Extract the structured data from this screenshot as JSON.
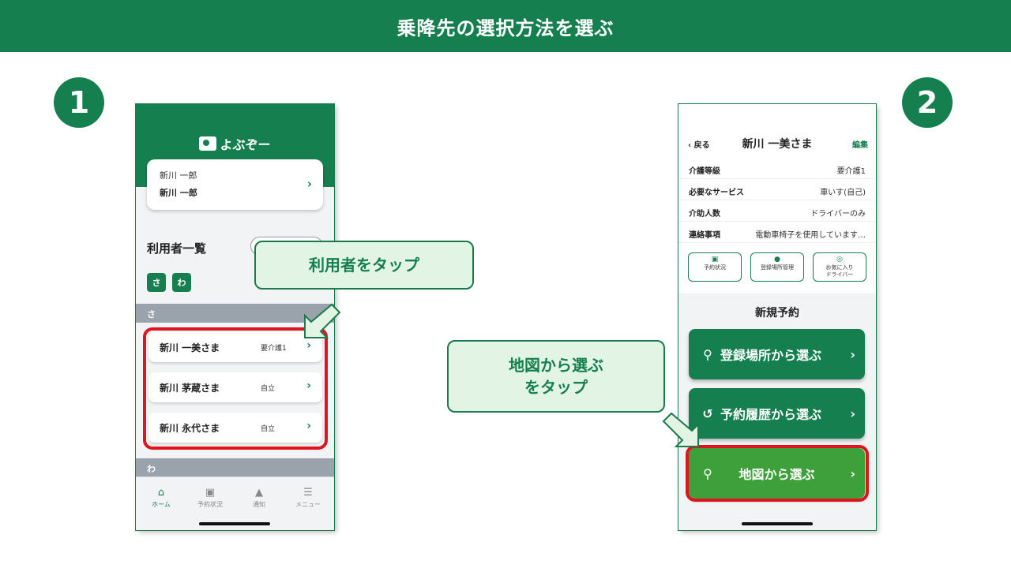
{
  "header": {
    "title": "乗降先の選択方法を選ぶ"
  },
  "steps": {
    "one": "❶",
    "two": "❷"
  },
  "phone1": {
    "app_name": "よぶぞー",
    "account": {
      "line1": "新川 一郎",
      "line2": "新川 一郎"
    },
    "list_title": "利用者一覧",
    "kana_buttons": [
      "さ",
      "わ"
    ],
    "sections": [
      "さ",
      "わ"
    ],
    "users": [
      {
        "name": "新川 一美さま",
        "badge": "要介護1"
      },
      {
        "name": "新川 茅蔵さま",
        "badge": "自立"
      },
      {
        "name": "新川 永代さま",
        "badge": "自立"
      }
    ],
    "tabs": [
      "ホーム",
      "予約状況",
      "通知",
      "メニュー"
    ]
  },
  "phone2": {
    "back": "戻る",
    "title": "新川 一美さま",
    "edit": "編集",
    "info": [
      {
        "k": "介護等級",
        "v": "要介護1"
      },
      {
        "k": "必要なサービス",
        "v": "車いす(自己)"
      },
      {
        "k": "介助人数",
        "v": "ドライバーのみ"
      },
      {
        "k": "連絡事項",
        "v": "電動車椅子を使用しています…"
      }
    ],
    "mini_buttons": [
      "予約状況",
      "登録場所管理",
      "お気に入り",
      "ドライバー"
    ],
    "section_title": "新規予約",
    "buttons": [
      "登録場所から選ぶ",
      "予約履歴から選ぶ",
      "地図から選ぶ"
    ]
  },
  "callouts": {
    "tap_user": "利用者をタップ",
    "tap_map_line1": "地図から選ぶ",
    "tap_map_line2": "をタップ"
  },
  "colors": {
    "brand": "#157f4f",
    "highlight": "#e0141e",
    "map_button": "#3ea03a",
    "callout_bg": "#e2f5e4"
  }
}
